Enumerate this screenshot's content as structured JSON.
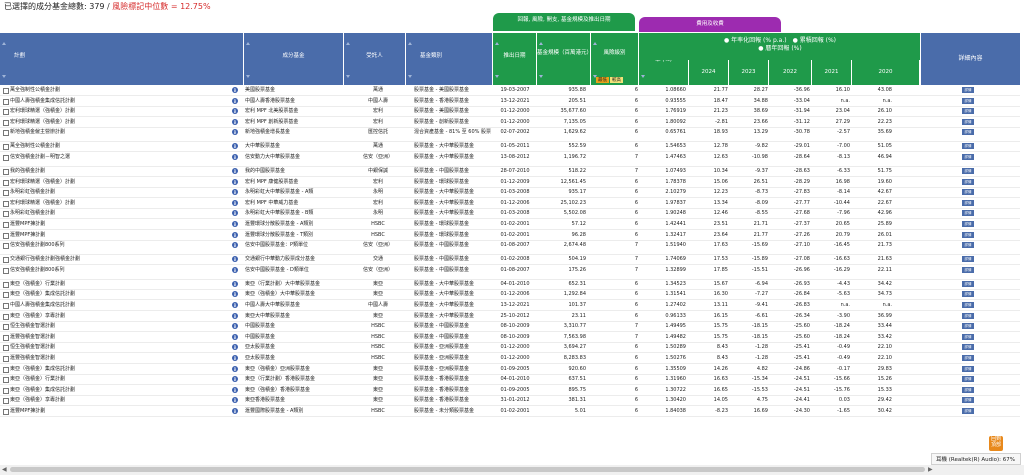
{
  "summary": {
    "count_text": "已選擇的成分基金總數: 379",
    "slash": " / ",
    "median_text": "風險標記中位數 = 12.75%"
  },
  "groups": {
    "returns": "回報, 風險, 開支, 基金規模及推出日期",
    "expense": "費用及收費"
  },
  "headers": {
    "plan": "計劃",
    "fund": "成分基金",
    "trustee": "受託人",
    "category": "基金類別",
    "launch": "推出日期",
    "size": "基金規模（百萬港元）",
    "risk": "風險級別",
    "expense": "最近期基金開支比率 (%)",
    "legend_line1": "● 年率化回報 (% p.a.)　● 累積回報 (%)",
    "legend_line2": "● 曆年回報 (%)",
    "years": [
      "2024",
      "2023",
      "2022",
      "2021",
      "2020"
    ],
    "detail": "詳細內容",
    "tag_a": "最低",
    "tag_b": "較高"
  },
  "rows": [
    {
      "plan": "萬全強制性公積金計劃",
      "fund": "美國股票基金",
      "trustee": "萬通",
      "cat": "股票基金 - 美國股票基金",
      "date": "19-03-2007",
      "size": "935.88",
      "risk": "6",
      "exp": "1.08660",
      "y2024": "21.77",
      "y2023": "28.27",
      "y2022": "-36.96",
      "y2021": "16.10",
      "y2020": "43.08"
    },
    {
      "plan": "中國人壽強積金集成信託計劃",
      "fund": "中國人壽香港股票基金",
      "trustee": "中國人壽",
      "cat": "股票基金 - 香港股票基金",
      "date": "13-12-2021",
      "size": "205.51",
      "risk": "6",
      "exp": "0.93555",
      "y2024": "18.47",
      "y2023": "34.88",
      "y2022": "-33.04",
      "y2021": "n.a.",
      "y2020": "n.a."
    },
    {
      "plan": "宏利環球精選（強積金）計劃",
      "fund": "宏利 MPF 北美股票基金",
      "trustee": "宏利",
      "cat": "股票基金 - 美國股票基金",
      "date": "01-12-2000",
      "size": "35,677.60",
      "risk": "6",
      "exp": "1.76919",
      "y2024": "21.23",
      "y2023": "38.69",
      "y2022": "-31.94",
      "y2021": "23.04",
      "y2020": "26.10"
    },
    {
      "plan": "宏利環球精選（強積金）計劃",
      "fund": "宏利 MPF 創新股票基金",
      "trustee": "宏利",
      "cat": "股票基金 - 創新股票基金",
      "date": "01-12-2000",
      "size": "7,135.05",
      "risk": "6",
      "exp": "1.80092",
      "y2024": "-2.81",
      "y2023": "23.66",
      "y2022": "-31.12",
      "y2021": "27.29",
      "y2020": "22.23"
    },
    {
      "plan": "新地強積金僱主營辦計劃",
      "fund": "新地強積金增長基金",
      "trustee": "匯控信託",
      "cat": "混合資產基金 - 81% 至 60% 股票",
      "date": "02-07-2002",
      "size": "1,629.62",
      "risk": "6",
      "exp": "0.65761",
      "y2024": "18.93",
      "y2023": "13.29",
      "y2022": "-30.78",
      "y2021": "-2.57",
      "y2020": "35.69",
      "tall": true
    },
    {
      "plan": "萬全強制性公積金計劃",
      "fund": "大中華股票基金",
      "trustee": "萬通",
      "cat": "股票基金 - 大中華股票基金",
      "date": "01-05-2011",
      "size": "552.59",
      "risk": "6",
      "exp": "1.54653",
      "y2024": "12.78",
      "y2023": "-9.82",
      "y2022": "-29.01",
      "y2021": "-7.00",
      "y2020": "51.05"
    },
    {
      "plan": "信安強積金計劃－明智之選",
      "fund": "信安動力大中華股票基金",
      "trustee": "信安（亞洲）",
      "cat": "股票基金 - 大中華股票基金",
      "date": "13-08-2012",
      "size": "1,196.72",
      "risk": "7",
      "exp": "1.47463",
      "y2024": "12.63",
      "y2023": "-10.98",
      "y2022": "-28.64",
      "y2021": "-8.13",
      "y2020": "46.94",
      "tall": true
    },
    {
      "plan": "我的強積金計劃",
      "fund": "我的中國股票基金",
      "trustee": "中銀保誠",
      "cat": "股票基金 - 中國股票基金",
      "date": "28-07-2010",
      "size": "518.22",
      "risk": "7",
      "exp": "1.07493",
      "y2024": "10.34",
      "y2023": "-9.37",
      "y2022": "-28.63",
      "y2021": "-6.33",
      "y2020": "51.75"
    },
    {
      "plan": "宏利環球精選（強積金）計劃",
      "fund": "宏利 MPF 康健股票基金",
      "trustee": "宏利",
      "cat": "股票基金 - 環球股票基金",
      "date": "01-12-2009",
      "size": "12,561.45",
      "risk": "6",
      "exp": "1.78378",
      "y2024": "15.06",
      "y2023": "26.51",
      "y2022": "-28.29",
      "y2021": "16.98",
      "y2020": "19.60"
    },
    {
      "plan": "永明彩虹強積金計劃",
      "fund": "永明彩虹大中華股票基金 - A類",
      "trustee": "永明",
      "cat": "股票基金 - 大中華股票基金",
      "date": "01-03-2008",
      "size": "935.17",
      "risk": "6",
      "exp": "2.10279",
      "y2024": "12.23",
      "y2023": "-8.73",
      "y2022": "-27.83",
      "y2021": "-8.14",
      "y2020": "42.67"
    },
    {
      "plan": "宏利環球精選（強積金）計劃",
      "fund": "宏利 MPF 中華威力基金",
      "trustee": "宏利",
      "cat": "股票基金 - 大中華股票基金",
      "date": "01-12-2006",
      "size": "25,102.23",
      "risk": "6",
      "exp": "1.97837",
      "y2024": "13.34",
      "y2023": "-8.09",
      "y2022": "-27.77",
      "y2021": "-10.44",
      "y2020": "22.67"
    },
    {
      "plan": "永明彩虹強積金計劃",
      "fund": "永明彩虹大中華股票基金 - B類",
      "trustee": "永明",
      "cat": "股票基金 - 大中華股票基金",
      "date": "01-03-2008",
      "size": "5,502.08",
      "risk": "6",
      "exp": "1.90248",
      "y2024": "12.46",
      "y2023": "-8.55",
      "y2022": "-27.68",
      "y2021": "-7.96",
      "y2020": "42.96"
    },
    {
      "plan": "滙豐MPF揀計劃",
      "fund": "滙豐環球分散股票基金 - A類別",
      "trustee": "HSBC",
      "cat": "股票基金 - 環球股票基金",
      "date": "01-02-2001",
      "size": "57.12",
      "risk": "6",
      "exp": "1.42441",
      "y2024": "23.51",
      "y2023": "21.71",
      "y2022": "-27.37",
      "y2021": "20.65",
      "y2020": "25.89"
    },
    {
      "plan": "滙豐MPF揀計劃",
      "fund": "滙豐環球分散股票基金 - T類別",
      "trustee": "HSBC",
      "cat": "股票基金 - 環球股票基金",
      "date": "01-02-2001",
      "size": "96.28",
      "risk": "6",
      "exp": "1.32417",
      "y2024": "23.64",
      "y2023": "21.77",
      "y2022": "-27.26",
      "y2021": "20.79",
      "y2020": "26.01"
    },
    {
      "plan": "信安強積金計劃800系列",
      "fund": "信安中國股票基金：P類單位",
      "trustee": "信安（亞洲）",
      "cat": "股票基金 - 中國股票基金",
      "date": "01-08-2007",
      "size": "2,674.48",
      "risk": "7",
      "exp": "1.51940",
      "y2024": "17.63",
      "y2023": "-15.69",
      "y2022": "-27.10",
      "y2021": "-16.45",
      "y2020": "21.73",
      "tall": true
    },
    {
      "plan": "交通銀行強積金計劃強積金計劃",
      "fund": "交通銀行中華動力股票成分基金",
      "trustee": "交通",
      "cat": "股票基金 - 中國股票基金",
      "date": "01-02-2008",
      "size": "504.19",
      "risk": "7",
      "exp": "1.74069",
      "y2024": "17.53",
      "y2023": "-15.89",
      "y2022": "-27.08",
      "y2021": "-16.63",
      "y2020": "21.63"
    },
    {
      "plan": "信安強積金計劃800系列",
      "fund": "信安中國股票基金 - D類單位",
      "trustee": "信安（亞洲）",
      "cat": "股票基金 - 中國股票基金",
      "date": "01-08-2007",
      "size": "175.26",
      "risk": "7",
      "exp": "1.32899",
      "y2024": "17.85",
      "y2023": "-15.51",
      "y2022": "-26.96",
      "y2021": "-16.29",
      "y2020": "22.11",
      "tall": true
    },
    {
      "plan": "東亞（強積金）行業計劃",
      "fund": "東亞（行業計劃）大中華股票基金",
      "trustee": "東亞",
      "cat": "股票基金 - 大中華股票基金",
      "date": "04-01-2010",
      "size": "652.31",
      "risk": "6",
      "exp": "1.34523",
      "y2024": "15.67",
      "y2023": "-6.94",
      "y2022": "-26.93",
      "y2021": "-4.43",
      "y2020": "34.42"
    },
    {
      "plan": "東亞（強積金）集成信託計劃",
      "fund": "東亞（強積金）大中華股票基金",
      "trustee": "東亞",
      "cat": "股票基金 - 大中華股票基金",
      "date": "01-12-2006",
      "size": "1,292.84",
      "risk": "6",
      "exp": "1.31541",
      "y2024": "16.30",
      "y2023": "-7.27",
      "y2022": "-26.84",
      "y2021": "-5.63",
      "y2020": "34.73"
    },
    {
      "plan": "中國人壽強積金集成信託計劃",
      "fund": "中國人壽大中華股票基金",
      "trustee": "中國人壽",
      "cat": "股票基金 - 大中華股票基金",
      "date": "13-12-2021",
      "size": "101.37",
      "risk": "6",
      "exp": "1.27402",
      "y2024": "13.11",
      "y2023": "-9.41",
      "y2022": "-26.83",
      "y2021": "n.a.",
      "y2020": "n.a."
    },
    {
      "plan": "東亞（強積金）享專計劃",
      "fund": "東亞大中華股票基金",
      "trustee": "東亞",
      "cat": "股票基金 - 大中華股票基金",
      "date": "25-10-2012",
      "size": "23.11",
      "risk": "6",
      "exp": "0.96133",
      "y2024": "16.15",
      "y2023": "-6.61",
      "y2022": "-26.34",
      "y2021": "-3.90",
      "y2020": "36.99"
    },
    {
      "plan": "恒生強積金智選計劃",
      "fund": "中國股票基金",
      "trustee": "HSBC",
      "cat": "股票基金 - 中國股票基金",
      "date": "08-10-2009",
      "size": "3,310.77",
      "risk": "7",
      "exp": "1.49495",
      "y2024": "15.75",
      "y2023": "-18.15",
      "y2022": "-25.60",
      "y2021": "-18.24",
      "y2020": "33.44"
    },
    {
      "plan": "滙豐強積金智選計劃",
      "fund": "中國股票基金",
      "trustee": "HSBC",
      "cat": "股票基金 - 中國股票基金",
      "date": "08-10-2009",
      "size": "7,563.98",
      "risk": "7",
      "exp": "1.49482",
      "y2024": "15.75",
      "y2023": "-18.15",
      "y2022": "-25.60",
      "y2021": "-18.24",
      "y2020": "33.42"
    },
    {
      "plan": "恒生強積金智選計劃",
      "fund": "亞太股票基金",
      "trustee": "HSBC",
      "cat": "股票基金 - 亞洲股票基金",
      "date": "01-12-2000",
      "size": "3,694.27",
      "risk": "6",
      "exp": "1.50289",
      "y2024": "8.43",
      "y2023": "-1.28",
      "y2022": "-25.41",
      "y2021": "-0.49",
      "y2020": "22.10"
    },
    {
      "plan": "滙豐強積金智選計劃",
      "fund": "亞太股票基金",
      "trustee": "HSBC",
      "cat": "股票基金 - 亞洲股票基金",
      "date": "01-12-2000",
      "size": "8,283.83",
      "risk": "6",
      "exp": "1.50276",
      "y2024": "8.43",
      "y2023": "-1.28",
      "y2022": "-25.41",
      "y2021": "-0.49",
      "y2020": "22.10"
    },
    {
      "plan": "東亞（強積金）集成信託計劃",
      "fund": "東亞（強積金）亞洲股票基金",
      "trustee": "東亞",
      "cat": "股票基金 - 亞洲股票基金",
      "date": "01-09-2005",
      "size": "920.60",
      "risk": "6",
      "exp": "1.35509",
      "y2024": "14.26",
      "y2023": "4.82",
      "y2022": "-24.86",
      "y2021": "-0.17",
      "y2020": "29.83"
    },
    {
      "plan": "東亞（強積金）行業計劃",
      "fund": "東亞（行業計劃）香港股票基金",
      "trustee": "東亞",
      "cat": "股票基金 - 香港股票基金",
      "date": "04-01-2010",
      "size": "637.51",
      "risk": "6",
      "exp": "1.31960",
      "y2024": "16.63",
      "y2023": "-15.34",
      "y2022": "-24.51",
      "y2021": "-15.66",
      "y2020": "15.26"
    },
    {
      "plan": "東亞（強積金）集成信託計劃",
      "fund": "東亞（強積金）香港股票基金",
      "trustee": "東亞",
      "cat": "股票基金 - 香港股票基金",
      "date": "01-09-2005",
      "size": "895.75",
      "risk": "6",
      "exp": "1.30722",
      "y2024": "16.65",
      "y2023": "-15.53",
      "y2022": "-24.51",
      "y2021": "-15.76",
      "y2020": "15.33"
    },
    {
      "plan": "東亞（強積金）享專計劃",
      "fund": "東亞香港股票基金",
      "trustee": "東亞",
      "cat": "股票基金 - 香港股票基金",
      "date": "31-01-2012",
      "size": "381.31",
      "risk": "6",
      "exp": "1.30420",
      "y2024": "14.05",
      "y2023": "4.75",
      "y2022": "-24.41",
      "y2021": "0.03",
      "y2020": "29.42"
    },
    {
      "plan": "滙豐MPF揀計劃",
      "fund": "滙豐國際股票基金 - A類別",
      "trustee": "HSBC",
      "cat": "股票基金 - 未分類股票基金",
      "date": "01-02-2001",
      "size": "5.01",
      "risk": "6",
      "exp": "1.84038",
      "y2024": "-8.23",
      "y2023": "16.69",
      "y2022": "-24.30",
      "y2021": "-1.65",
      "y2020": "30.42"
    }
  ],
  "detail_btn": "詳情",
  "icon_letter": "B",
  "toast": "耳機 (Realtek(R) Audio): 67%",
  "uptop": "回到頂部",
  "scroll_left": "◀",
  "scroll_right": "▶"
}
